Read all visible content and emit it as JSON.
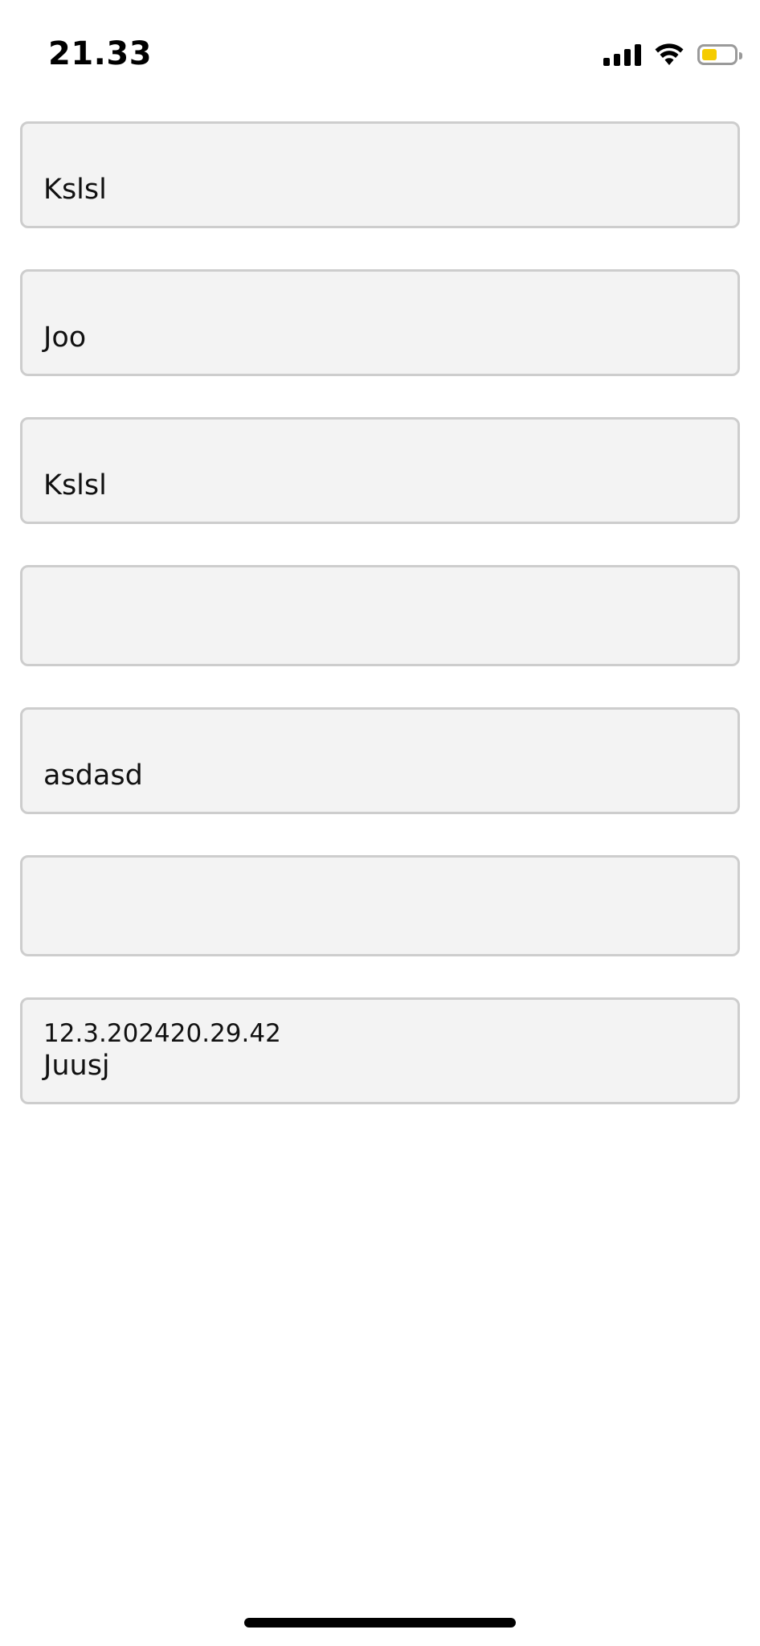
{
  "status_bar": {
    "time": "21.33",
    "battery_color": "#f5cc00",
    "icons": [
      "cellular-signal-icon",
      "wifi-icon",
      "battery-icon"
    ]
  },
  "notes": [
    {
      "date": "",
      "text": "Kslsl"
    },
    {
      "date": "",
      "text": "Joo"
    },
    {
      "date": "",
      "text": "Kslsl"
    },
    {
      "date": "",
      "text": ""
    },
    {
      "date": "",
      "text": "asdasd"
    },
    {
      "date": "",
      "text": ""
    },
    {
      "date": "12.3.202420.29.42",
      "text": "Juusj"
    }
  ]
}
